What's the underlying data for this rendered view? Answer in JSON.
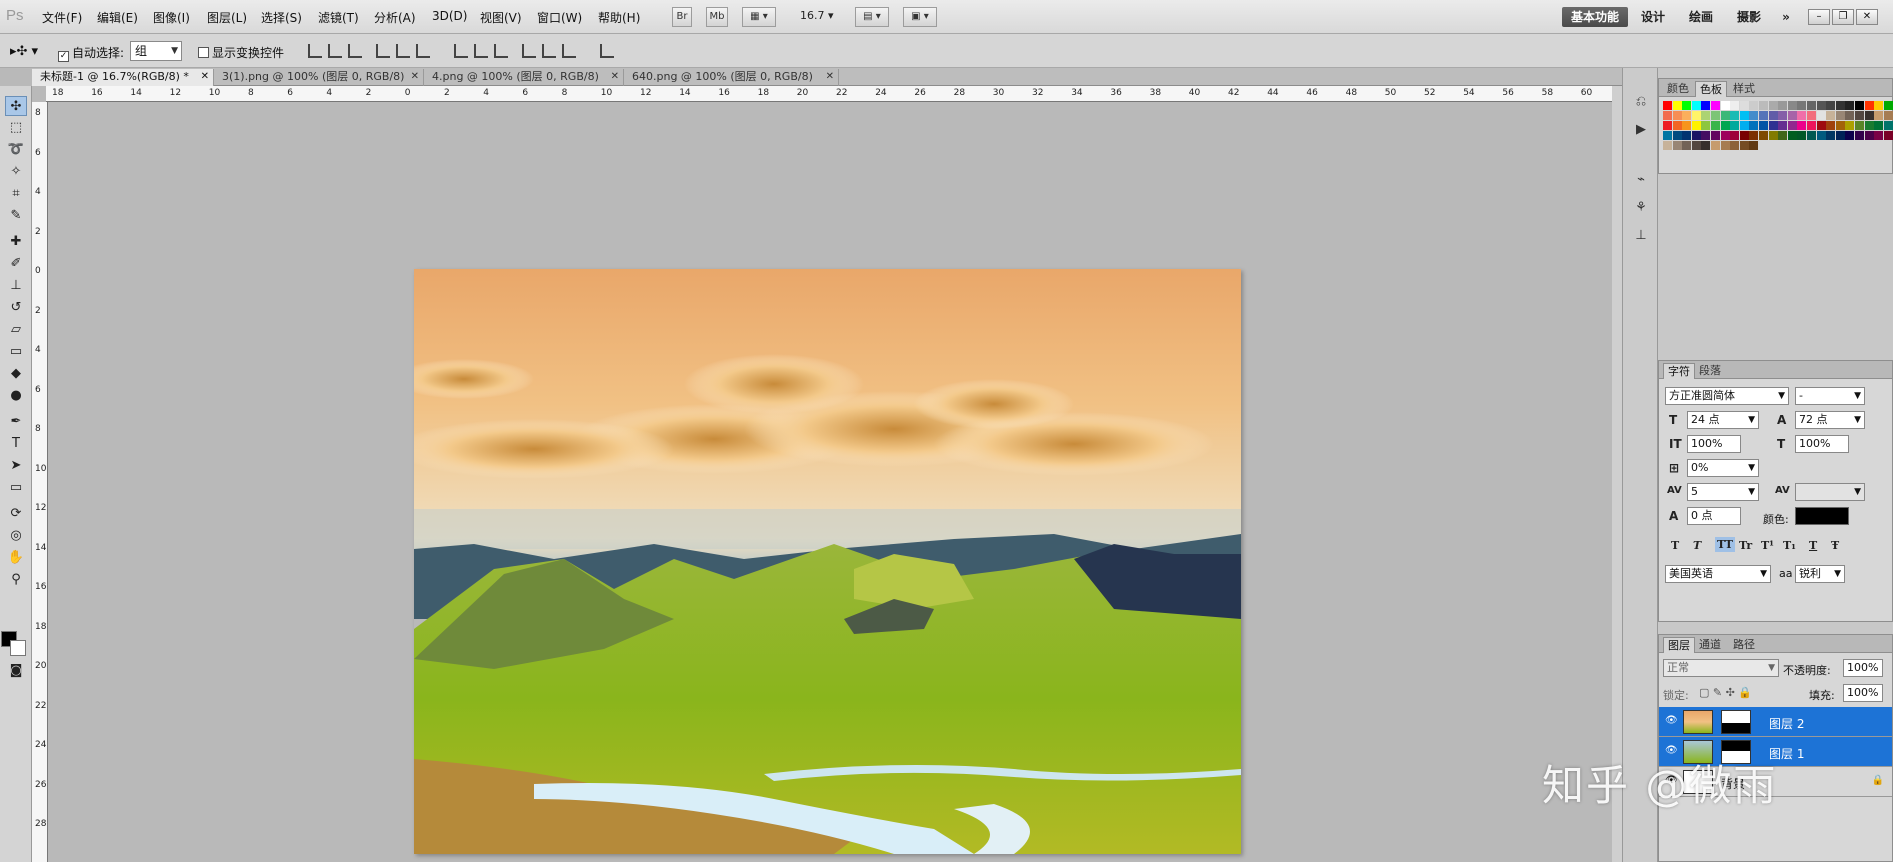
{
  "app": {
    "logo": "Ps"
  },
  "menu": [
    "文件(F)",
    "编辑(E)",
    "图像(I)",
    "图层(L)",
    "选择(S)",
    "滤镜(T)",
    "分析(A)",
    "3D(D)",
    "视图(V)",
    "窗口(W)",
    "帮助(H)"
  ],
  "menu_buttons": [
    "Br",
    "Mb"
  ],
  "zoom": "16.7",
  "workspaces": [
    "基本功能",
    "设计",
    "绘画",
    "摄影"
  ],
  "workspace_more": "»",
  "options": {
    "auto_select_label": "自动选择:",
    "auto_select_value": "组",
    "transform_controls_label": "显示变换控件"
  },
  "doc_tabs": [
    {
      "label": "未标题-1 @ 16.7%(RGB/8) *",
      "active": true
    },
    {
      "label": "3(1).png @ 100% (图层 0, RGB/8)",
      "active": false
    },
    {
      "label": "4.png @ 100% (图层 0, RGB/8)",
      "active": false
    },
    {
      "label": "640.png @ 100% (图层 0, RGB/8)",
      "active": false
    }
  ],
  "ruler_top": [
    "18",
    "16",
    "14",
    "12",
    "10",
    "8",
    "6",
    "4",
    "2",
    "0",
    "2",
    "4",
    "6",
    "8",
    "10",
    "12",
    "14",
    "16",
    "18",
    "20",
    "22",
    "24",
    "26",
    "28",
    "30",
    "32",
    "34",
    "36",
    "38",
    "40",
    "42",
    "44",
    "46",
    "48",
    "50",
    "52",
    "54",
    "56",
    "58",
    "60"
  ],
  "ruler_left": [
    "8",
    "6",
    "4",
    "2",
    "0",
    "2",
    "4",
    "6",
    "8",
    "10",
    "12",
    "14",
    "16",
    "18",
    "20",
    "22",
    "24",
    "26",
    "28"
  ],
  "swatch_panel": {
    "tabs": [
      "颜色",
      "色板",
      "样式"
    ],
    "active": "色板"
  },
  "character_panel": {
    "tabs": [
      "字符",
      "段落"
    ],
    "font_family": "方正准圆简体",
    "font_style": "-",
    "font_size": "24 点",
    "leading": "72 点",
    "vertical_scale": "100%",
    "horizontal_scale": "100%",
    "tsume": "0%",
    "tracking": "5",
    "baseline_shift": "0 点",
    "color_label": "颜色:",
    "language": "美国英语",
    "antialias_label": "aa",
    "antialias": "锐利",
    "styles": [
      "T",
      "T",
      "TT",
      "Tr",
      "T¹",
      "T₁",
      "T",
      "Ŧ"
    ]
  },
  "layers_panel": {
    "tabs": [
      "图层",
      "通道",
      "路径"
    ],
    "blend_mode": "正常",
    "opacity_label": "不透明度:",
    "opacity": "100%",
    "lock_label": "锁定:",
    "fill_label": "填充:",
    "fill": "100%",
    "layers": [
      {
        "name": "图层 2",
        "selected": true
      },
      {
        "name": "图层 1",
        "selected": true
      },
      {
        "name": "背景",
        "selected": false
      }
    ]
  },
  "watermark": "知乎 @微雨"
}
